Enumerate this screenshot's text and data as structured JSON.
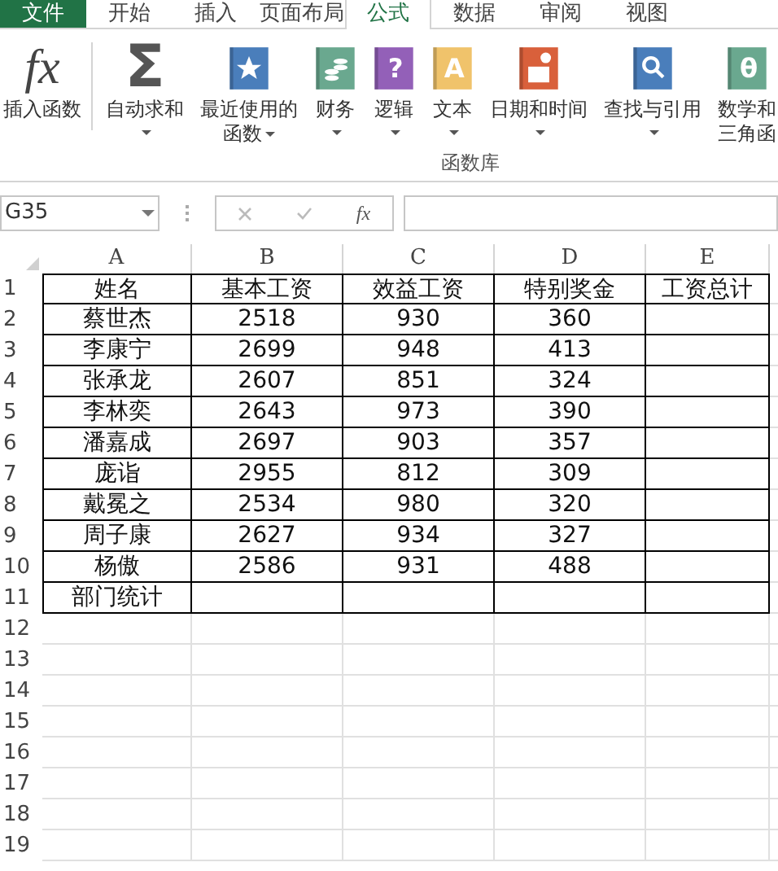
{
  "ribbon_tabs": [
    {
      "label": "文件",
      "kind": "file",
      "selected": false
    },
    {
      "label": "开始",
      "kind": "tab",
      "selected": false
    },
    {
      "label": "插入",
      "kind": "tab",
      "selected": false
    },
    {
      "label": "页面布局",
      "kind": "tab",
      "selected": false
    },
    {
      "label": "公式",
      "kind": "tab",
      "selected": true
    },
    {
      "label": "数据",
      "kind": "tab",
      "selected": false
    },
    {
      "label": "审阅",
      "kind": "tab",
      "selected": false
    },
    {
      "label": "视图",
      "kind": "tab",
      "selected": false
    }
  ],
  "ribbon": {
    "buttons": [
      {
        "kind": "glyph",
        "icon_text": "fx",
        "lines": [
          "插入函数"
        ],
        "dropdown": false
      },
      {
        "kind": "glyph",
        "icon_text": "Σ",
        "lines": [
          "自动求和"
        ],
        "dropdown": true
      },
      {
        "kind": "book",
        "color": "#4a7ebb",
        "lines": [
          "最近使用的",
          "函数"
        ],
        "dropdown": true
      },
      {
        "kind": "book",
        "color": "#6aa88f",
        "lines": [
          "财务"
        ],
        "dropdown": true
      },
      {
        "kind": "book",
        "color": "#9360b8",
        "icon_text": "?",
        "lines": [
          "逻辑"
        ],
        "dropdown": true
      },
      {
        "kind": "book",
        "color": "#f0c36b",
        "icon_text": "A",
        "lines": [
          "文本"
        ],
        "dropdown": true
      },
      {
        "kind": "book",
        "color": "#d9603b",
        "lines": [
          "日期和时间"
        ],
        "dropdown": true
      },
      {
        "kind": "book",
        "color": "#4a7ebb",
        "lines": [
          "查找与引用"
        ],
        "dropdown": true
      },
      {
        "kind": "book",
        "color": "#6aa88f",
        "icon_text": "θ",
        "lines": [
          "数学和",
          "三角函"
        ],
        "dropdown": false
      }
    ],
    "group_label": "函数库"
  },
  "formula_bar": {
    "name_box": "G35",
    "fx": "fx"
  },
  "columns": [
    "A",
    "B",
    "C",
    "D",
    "E"
  ],
  "row_numbers": [
    "1",
    "2",
    "3",
    "4",
    "5",
    "6",
    "7",
    "8",
    "9",
    "10",
    "11",
    "12",
    "13",
    "14",
    "15",
    "16",
    "17",
    "18",
    "19"
  ],
  "table": {
    "rows": [
      [
        "姓名",
        "基本工资",
        "效益工资",
        "特别奖金",
        "工资总计"
      ],
      [
        "蔡世杰",
        "2518",
        "930",
        "360",
        ""
      ],
      [
        "李康宁",
        "2699",
        "948",
        "413",
        ""
      ],
      [
        "张承龙",
        "2607",
        "851",
        "324",
        ""
      ],
      [
        "李林奕",
        "2643",
        "973",
        "390",
        ""
      ],
      [
        "潘嘉成",
        "2697",
        "903",
        "357",
        ""
      ],
      [
        "庞诣",
        "2955",
        "812",
        "309",
        ""
      ],
      [
        "戴冕之",
        "2534",
        "980",
        "320",
        ""
      ],
      [
        "周子康",
        "2627",
        "934",
        "327",
        ""
      ],
      [
        "杨傲",
        "2586",
        "931",
        "488",
        ""
      ],
      [
        "部门统计",
        "",
        "",
        "",
        ""
      ]
    ]
  }
}
